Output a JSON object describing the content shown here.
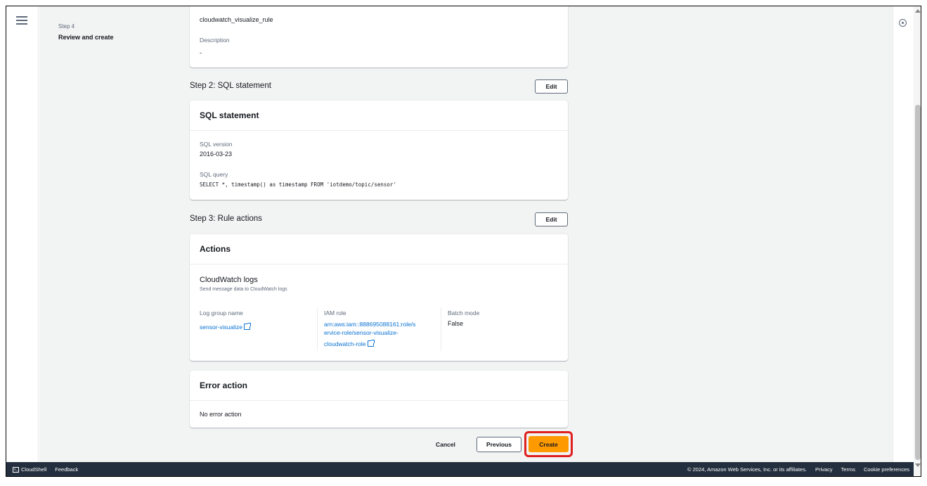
{
  "wizard": {
    "steps": [
      {
        "number": "Step 4",
        "label": "Review and create"
      }
    ]
  },
  "rule_card": {
    "rule_name": "cloudwatch_visualize_rule",
    "description_label": "Description",
    "description_value": "-"
  },
  "sql_section": {
    "title": "Step 2: SQL statement",
    "edit_label": "Edit",
    "card_title": "SQL statement",
    "version_label": "SQL version",
    "version_value": "2016-03-23",
    "query_label": "SQL query",
    "query_value": "SELECT *, timestamp() as timestamp FROM 'iotdemo/topic/sensor'"
  },
  "actions_section": {
    "title": "Step 3: Rule actions",
    "edit_label": "Edit",
    "card_title": "Actions",
    "action_name": "CloudWatch logs",
    "action_desc": "Send message data to CloudWatch logs",
    "log_group_label": "Log group name",
    "log_group_value": "sensor-visualize",
    "iam_role_label": "IAM role",
    "iam_role_lines": [
      "arn:aws:iam::888695088161:role/s",
      "ervice-role/sensor-visualize-",
      "cloudwatch-role"
    ],
    "batch_mode_label": "Batch mode",
    "batch_mode_value": "False"
  },
  "error_section": {
    "card_title": "Error action",
    "value": "No error action"
  },
  "footer_buttons": {
    "cancel": "Cancel",
    "previous": "Previous",
    "create": "Create"
  },
  "bottom_bar": {
    "cloudshell": "CloudShell",
    "feedback": "Feedback",
    "copyright": "© 2024, Amazon Web Services, Inc. or its affiliates.",
    "privacy": "Privacy",
    "terms": "Terms",
    "cookie": "Cookie preferences"
  },
  "colors": {
    "primary_button": "#ff9900",
    "highlight_ring": "#e01f1f",
    "link": "#0972d3",
    "bottom_bar": "#232f3e"
  }
}
